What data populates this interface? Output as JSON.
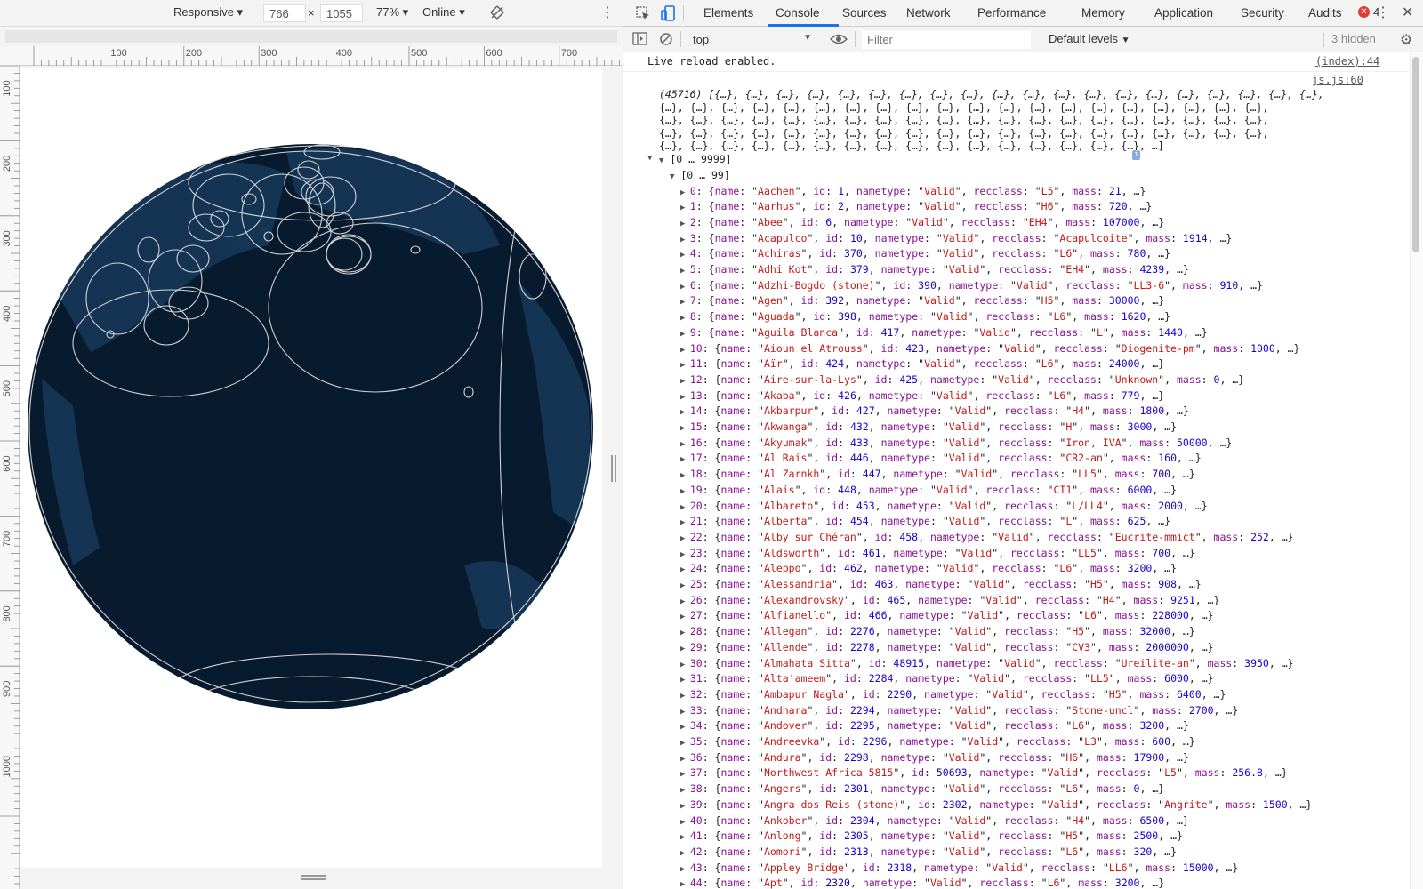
{
  "device_toolbar": {
    "mode": "Responsive",
    "width": "766",
    "x_sign": "×",
    "height": "1055",
    "zoom": "77%",
    "throttle": "Online"
  },
  "ruler": {
    "h": [
      "100",
      "200",
      "300",
      "400",
      "500",
      "600",
      "700"
    ],
    "v": [
      "100",
      "200",
      "300",
      "400",
      "500",
      "600",
      "700",
      "800",
      "900",
      "1000"
    ]
  },
  "tabs": [
    {
      "label": "Elements"
    },
    {
      "label": "Console"
    },
    {
      "label": "Sources"
    },
    {
      "label": "Network"
    },
    {
      "label": "Performance"
    },
    {
      "label": "Memory"
    },
    {
      "label": "Application"
    },
    {
      "label": "Security"
    },
    {
      "label": "Audits"
    }
  ],
  "active_tab": "Console",
  "error_count": "4",
  "console_toolbar": {
    "context": "top",
    "filter_placeholder": "Filter",
    "levels": "Default levels",
    "hidden": "3 hidden"
  },
  "messages": {
    "live_reload": "Live reload enabled.",
    "live_reload_src": "(index):44",
    "array_src": "js.js:60",
    "array_lines": [
      "(45716) [{…}, {…}, {…}, {…}, {…}, {…}, {…}, {…}, {…}, {…}, {…}, {…}, {…}, {…}, {…}, {…}, {…}, {…}, {…}, {…},",
      "{…}, {…}, {…}, {…}, {…}, {…}, {…}, {…}, {…}, {…}, {…}, {…}, {…}, {…}, {…}, {…}, {…}, {…}, {…}, {…},",
      "{…}, {…}, {…}, {…}, {…}, {…}, {…}, {…}, {…}, {…}, {…}, {…}, {…}, {…}, {…}, {…}, {…}, {…}, {…}, {…},",
      "{…}, {…}, {…}, {…}, {…}, {…}, {…}, {…}, {…}, {…}, {…}, {…}, {…}, {…}, {…}, {…}, {…}, {…}, {…}, {…},",
      "{…}, {…}, {…}, {…}, {…}, {…}, {…}, {…}, {…}, {…}, {…}, {…}, {…}, {…}, {…}, {…}, …]"
    ],
    "group1": "[0 … 9999]",
    "group2": "[0 … 99]"
  },
  "entries": [
    [
      "0",
      "Aachen",
      "1",
      "Valid",
      "L5",
      "21"
    ],
    [
      "1",
      "Aarhus",
      "2",
      "Valid",
      "H6",
      "720"
    ],
    [
      "2",
      "Abee",
      "6",
      "Valid",
      "EH4",
      "107000"
    ],
    [
      "3",
      "Acapulco",
      "10",
      "Valid",
      "Acapulcoite",
      "1914"
    ],
    [
      "4",
      "Achiras",
      "370",
      "Valid",
      "L6",
      "780"
    ],
    [
      "5",
      "Adhi Kot",
      "379",
      "Valid",
      "EH4",
      "4239"
    ],
    [
      "6",
      "Adzhi-Bogdo (stone)",
      "390",
      "Valid",
      "LL3-6",
      "910"
    ],
    [
      "7",
      "Agen",
      "392",
      "Valid",
      "H5",
      "30000"
    ],
    [
      "8",
      "Aguada",
      "398",
      "Valid",
      "L6",
      "1620"
    ],
    [
      "9",
      "Aguila Blanca",
      "417",
      "Valid",
      "L",
      "1440"
    ],
    [
      "10",
      "Aioun el Atrouss",
      "423",
      "Valid",
      "Diogenite-pm",
      "1000"
    ],
    [
      "11",
      "Aïr",
      "424",
      "Valid",
      "L6",
      "24000"
    ],
    [
      "12",
      "Aire-sur-la-Lys",
      "425",
      "Valid",
      "Unknown",
      "0"
    ],
    [
      "13",
      "Akaba",
      "426",
      "Valid",
      "L6",
      "779"
    ],
    [
      "14",
      "Akbarpur",
      "427",
      "Valid",
      "H4",
      "1800"
    ],
    [
      "15",
      "Akwanga",
      "432",
      "Valid",
      "H",
      "3000"
    ],
    [
      "16",
      "Akyumak",
      "433",
      "Valid",
      "Iron, IVA",
      "50000"
    ],
    [
      "17",
      "Al Rais",
      "446",
      "Valid",
      "CR2-an",
      "160"
    ],
    [
      "18",
      "Al Zarnkh",
      "447",
      "Valid",
      "LL5",
      "700"
    ],
    [
      "19",
      "Alais",
      "448",
      "Valid",
      "CI1",
      "6000"
    ],
    [
      "20",
      "Albareto",
      "453",
      "Valid",
      "L/LL4",
      "2000"
    ],
    [
      "21",
      "Alberta",
      "454",
      "Valid",
      "L",
      "625"
    ],
    [
      "22",
      "Alby sur Chéran",
      "458",
      "Valid",
      "Eucrite-mmict",
      "252"
    ],
    [
      "23",
      "Aldsworth",
      "461",
      "Valid",
      "LL5",
      "700"
    ],
    [
      "24",
      "Aleppo",
      "462",
      "Valid",
      "L6",
      "3200"
    ],
    [
      "25",
      "Alessandria",
      "463",
      "Valid",
      "H5",
      "908"
    ],
    [
      "26",
      "Alexandrovsky",
      "465",
      "Valid",
      "H4",
      "9251"
    ],
    [
      "27",
      "Alfianello",
      "466",
      "Valid",
      "L6",
      "228000"
    ],
    [
      "28",
      "Allegan",
      "2276",
      "Valid",
      "H5",
      "32000"
    ],
    [
      "29",
      "Allende",
      "2278",
      "Valid",
      "CV3",
      "2000000"
    ],
    [
      "30",
      "Almahata Sitta",
      "48915",
      "Valid",
      "Ureilite-an",
      "3950"
    ],
    [
      "31",
      "Alta'ameem",
      "2284",
      "Valid",
      "LL5",
      "6000"
    ],
    [
      "32",
      "Ambapur Nagla",
      "2290",
      "Valid",
      "H5",
      "6400"
    ],
    [
      "33",
      "Andhara",
      "2294",
      "Valid",
      "Stone-uncl",
      "2700"
    ],
    [
      "34",
      "Andover",
      "2295",
      "Valid",
      "L6",
      "3200"
    ],
    [
      "35",
      "Andreevka",
      "2296",
      "Valid",
      "L3",
      "600"
    ],
    [
      "36",
      "Andura",
      "2298",
      "Valid",
      "H6",
      "17900"
    ],
    [
      "37",
      "Northwest Africa 5815",
      "50693",
      "Valid",
      "L5",
      "256.8"
    ],
    [
      "38",
      "Angers",
      "2301",
      "Valid",
      "L6",
      "0"
    ],
    [
      "39",
      "Angra dos Reis (stone)",
      "2302",
      "Valid",
      "Angrite",
      "1500"
    ],
    [
      "40",
      "Ankober",
      "2304",
      "Valid",
      "H4",
      "6500"
    ],
    [
      "41",
      "Anlong",
      "2305",
      "Valid",
      "H5",
      "2500"
    ],
    [
      "42",
      "Aomori",
      "2313",
      "Valid",
      "L6",
      "320"
    ],
    [
      "43",
      "Appley Bridge",
      "2318",
      "Valid",
      "LL6",
      "15000"
    ],
    [
      "44",
      "Apt",
      "2320",
      "Valid",
      "L6",
      "3200"
    ]
  ]
}
